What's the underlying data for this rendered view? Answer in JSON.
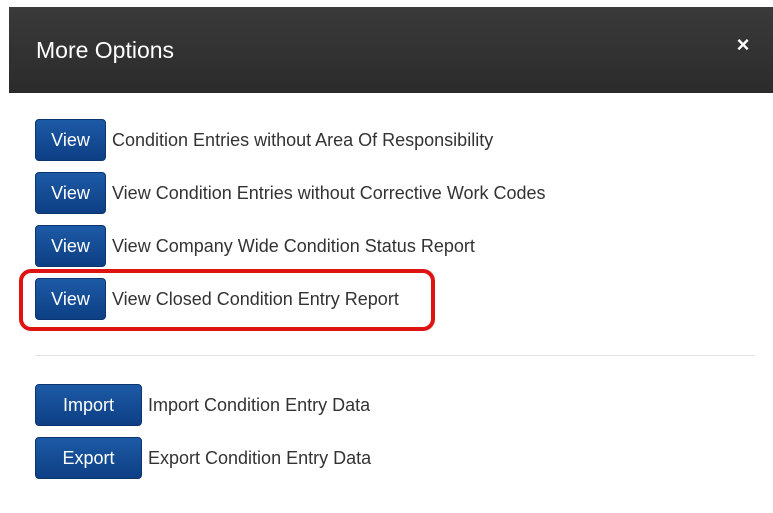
{
  "modal": {
    "title": "More Options",
    "close_icon": "close-icon",
    "close_glyph": "×"
  },
  "report_rows": [
    {
      "button_label": "View",
      "description": "Condition Entries without Area Of Responsibility"
    },
    {
      "button_label": "View",
      "description": "View Condition Entries without Corrective Work Codes"
    },
    {
      "button_label": "View",
      "description": "View Company Wide Condition Status Report"
    },
    {
      "button_label": "View",
      "description": "View Closed Condition Entry Report"
    }
  ],
  "data_rows": [
    {
      "button_label": "Import",
      "description": "Import Condition Entry Data"
    },
    {
      "button_label": "Export",
      "description": "Export Condition Entry Data"
    }
  ],
  "highlighted_row": "View Closed Condition Entry Report",
  "colors": {
    "header_bg": "#2b2b2b",
    "button_bg": "#0d3f84",
    "highlight_border": "#e01313",
    "text": "#333333"
  }
}
